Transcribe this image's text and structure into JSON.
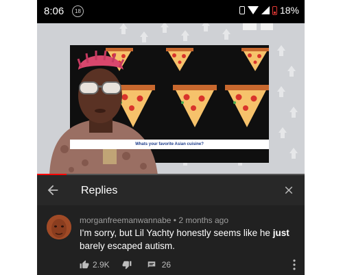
{
  "status_bar": {
    "time": "8:06",
    "notification_count": "18",
    "battery": "18%"
  },
  "video": {
    "caption": "Whats your favorite Asian cuisine?",
    "progress": 0.11
  },
  "replies": {
    "title": "Replies"
  },
  "comment": {
    "author": "morganfreemanwannabe",
    "separator": "•",
    "time": "2 months ago",
    "text_before": "I'm sorry, but Lil Yachty honestly seems like he ",
    "text_bold": "just",
    "text_after": " barely escaped autism.",
    "likes": "2.9K",
    "replies_count": "26"
  },
  "icons": {
    "back": "arrow-left-icon",
    "close": "close-icon",
    "like": "thumb-up-icon",
    "dislike": "thumb-down-icon",
    "reply": "comment-icon",
    "more": "more-vert-icon"
  }
}
